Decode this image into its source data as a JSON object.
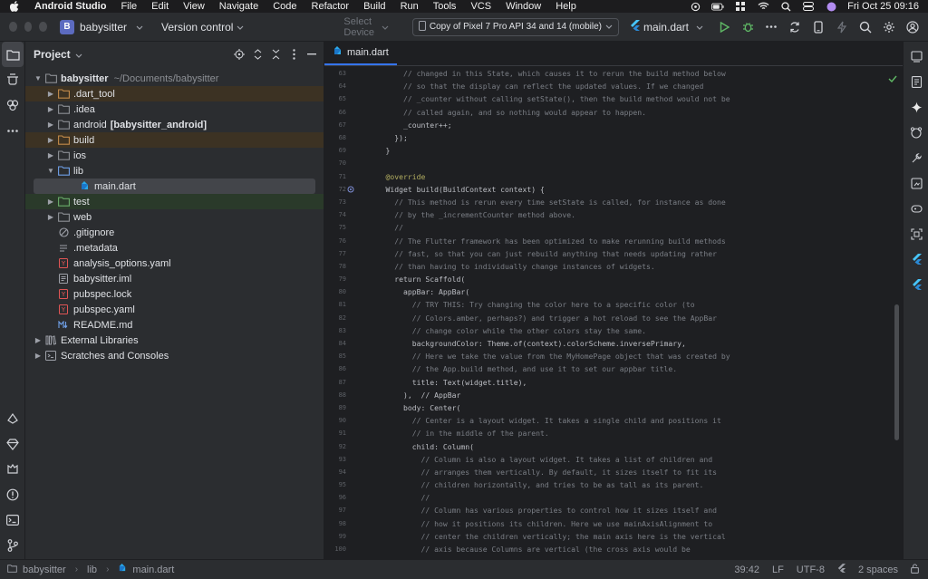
{
  "menubar": {
    "app_name": "Android Studio",
    "items": [
      "File",
      "Edit",
      "View",
      "Navigate",
      "Code",
      "Refactor",
      "Build",
      "Run",
      "Tools",
      "VCS",
      "Window",
      "Help"
    ],
    "clock": "Fri Oct 25  09:16"
  },
  "toolbar": {
    "project_badge": "B",
    "project_name": "babysitter",
    "version_control": "Version control",
    "select_device": "Select Device",
    "device": "Copy of Pixel 7 Pro API 34 and 14 (mobile)",
    "run_config": "main.dart"
  },
  "project_panel": {
    "title": "Project",
    "root_name": "babysitter",
    "root_path": "~/Documents/babysitter",
    "items": [
      {
        "label": ".dart_tool",
        "extra": "",
        "icon": "folder-icon"
      },
      {
        "label": ".idea",
        "extra": "",
        "icon": "folder-icon"
      },
      {
        "label": "android",
        "extra": "[babysitter_android]",
        "icon": "folder-icon"
      },
      {
        "label": "build",
        "extra": "",
        "icon": "folder-icon"
      },
      {
        "label": "ios",
        "extra": "",
        "icon": "folder-icon"
      },
      {
        "label": "lib",
        "extra": "",
        "icon": "folder-icon"
      },
      {
        "label": "main.dart",
        "extra": "",
        "icon": "dart-file-icon"
      },
      {
        "label": "test",
        "extra": "",
        "icon": "folder-icon"
      },
      {
        "label": "web",
        "extra": "",
        "icon": "folder-icon"
      },
      {
        "label": ".gitignore",
        "extra": "",
        "icon": "ignore-file-icon"
      },
      {
        "label": ".metadata",
        "extra": "",
        "icon": "text-file-icon"
      },
      {
        "label": "analysis_options.yaml",
        "extra": "",
        "icon": "yaml-file-icon"
      },
      {
        "label": "babysitter.iml",
        "extra": "",
        "icon": "module-file-icon"
      },
      {
        "label": "pubspec.lock",
        "extra": "",
        "icon": "yaml-file-icon"
      },
      {
        "label": "pubspec.yaml",
        "extra": "",
        "icon": "yaml-file-icon"
      },
      {
        "label": "README.md",
        "extra": "",
        "icon": "markdown-file-icon"
      },
      {
        "label": "External Libraries",
        "extra": "",
        "icon": "library-icon"
      },
      {
        "label": "Scratches and Consoles",
        "extra": "",
        "icon": "scratch-icon"
      }
    ]
  },
  "editor": {
    "tab_label": "main.dart",
    "lines": [
      {
        "n": "63",
        "t": "        // changed in this State, which causes it to rerun the build method below"
      },
      {
        "n": "64",
        "t": "        // so that the display can reflect the updated values. If we changed"
      },
      {
        "n": "65",
        "t": "        // _counter without calling setState(), then the build method would not be"
      },
      {
        "n": "66",
        "t": "        // called again, and so nothing would appear to happen."
      },
      {
        "n": "67",
        "t": "        _counter++;"
      },
      {
        "n": "68",
        "t": "      });"
      },
      {
        "n": "69",
        "t": "    }"
      },
      {
        "n": "70",
        "t": ""
      },
      {
        "n": "71",
        "t": "    @override"
      },
      {
        "n": "72",
        "t": "    Widget build(BuildContext context) {"
      },
      {
        "n": "73",
        "t": "      // This method is rerun every time setState is called, for instance as done"
      },
      {
        "n": "74",
        "t": "      // by the _incrementCounter method above."
      },
      {
        "n": "75",
        "t": "      //"
      },
      {
        "n": "76",
        "t": "      // The Flutter framework has been optimized to make rerunning build methods"
      },
      {
        "n": "77",
        "t": "      // fast, so that you can just rebuild anything that needs updating rather"
      },
      {
        "n": "78",
        "t": "      // than having to individually change instances of widgets."
      },
      {
        "n": "79",
        "t": "      return Scaffold("
      },
      {
        "n": "80",
        "t": "        appBar: AppBar("
      },
      {
        "n": "81",
        "t": "          // TRY THIS: Try changing the color here to a specific color (to"
      },
      {
        "n": "82",
        "t": "          // Colors.amber, perhaps?) and trigger a hot reload to see the AppBar"
      },
      {
        "n": "83",
        "t": "          // change color while the other colors stay the same."
      },
      {
        "n": "84",
        "t": "          backgroundColor: Theme.of(context).colorScheme.inversePrimary,"
      },
      {
        "n": "85",
        "t": "          // Here we take the value from the MyHomePage object that was created by"
      },
      {
        "n": "86",
        "t": "          // the App.build method, and use it to set our appbar title."
      },
      {
        "n": "87",
        "t": "          title: Text(widget.title),"
      },
      {
        "n": "88",
        "t": "        ),  // AppBar"
      },
      {
        "n": "89",
        "t": "        body: Center("
      },
      {
        "n": "90",
        "t": "          // Center is a layout widget. It takes a single child and positions it"
      },
      {
        "n": "91",
        "t": "          // in the middle of the parent."
      },
      {
        "n": "92",
        "t": "          child: Column("
      },
      {
        "n": "93",
        "t": "            // Column is also a layout widget. It takes a list of children and"
      },
      {
        "n": "94",
        "t": "            // arranges them vertically. By default, it sizes itself to fit its"
      },
      {
        "n": "95",
        "t": "            // children horizontally, and tries to be as tall as its parent."
      },
      {
        "n": "96",
        "t": "            //"
      },
      {
        "n": "97",
        "t": "            // Column has various properties to control how it sizes itself and"
      },
      {
        "n": "98",
        "t": "            // how it positions its children. Here we use mainAxisAlignment to"
      },
      {
        "n": "99",
        "t": "            // center the children vertically; the main axis here is the vertical"
      },
      {
        "n": "100",
        "t": "            // axis because Columns are vertical (the cross axis would be"
      }
    ]
  },
  "statusbar": {
    "crumbs": [
      "babysitter",
      "lib",
      "main.dart"
    ],
    "position": "39:42",
    "line_sep": "LF",
    "encoding": "UTF-8",
    "indent": "2 spaces"
  },
  "colors": {
    "accent": "#3574f0",
    "folder": "#8c8f94",
    "excluded_bg": "#3c3223",
    "test_bg": "#2a3a2a"
  }
}
